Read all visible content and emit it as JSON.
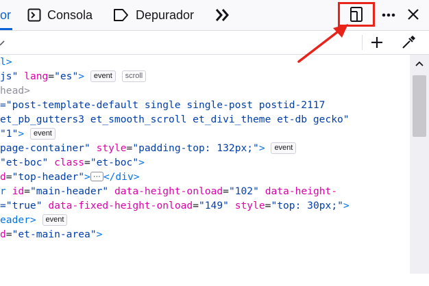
{
  "toolbar": {
    "tabs": [
      {
        "label": "or",
        "icon": "inspector-icon"
      },
      {
        "label": "Consola",
        "icon": "console-icon"
      },
      {
        "label": "Depurador",
        "icon": "debugger-icon"
      }
    ],
    "overflow_icon": "chevrons-right-icon",
    "responsive_icon": "responsive-design-icon",
    "more_icon": "more-dots-icon",
    "close_icon": "close-icon",
    "accent_color": "#0b63d8",
    "highlight_color": "#e8231a"
  },
  "search": {
    "placeholder": "",
    "add_node_icon": "plus-icon",
    "picker_icon": "eyedropper-icon"
  },
  "markup": {
    "l0": {
      "tag": "l>"
    },
    "l1": {
      "a": "js\"",
      "attr": "lang",
      "val": "\"es\"",
      "end": ">",
      "b1": "event",
      "b2": "scroll"
    },
    "l2": {
      "text": "head>"
    },
    "l3": {
      "val": "=\"post-template-default single single-post postid-2117"
    },
    "l4": {
      "val": "et_pb_gutters3 et_smooth_scroll et_divi_theme et-db gecko\""
    },
    "l5": {
      "val": "\"1\"",
      "end": ">",
      "b1": "event"
    },
    "l6": {
      "val": "page-container\"",
      "attr": "style",
      "val2": "\"padding-top: 132px;\"",
      "end": ">",
      "b1": "event"
    },
    "l7": {
      "val": "\"et-boc\"",
      "attr": "class",
      "val2": "\"et-boc\"",
      "end": ">"
    },
    "l8": {
      "a": "d",
      "val": "\"top-header\"",
      "end": ">",
      "close": "</div>"
    },
    "l9": {
      "tag": "r",
      "attr": "id",
      "val": "\"main-header\"",
      "attr2": "data-height-onload",
      "val2": "\"102\"",
      "attr3": "data-height-"
    },
    "l10": {
      "val": "=\"true\"",
      "attr": "data-fixed-height-onload",
      "val2": "\"149\"",
      "attr2": "style",
      "val3": "\"top: 30px;\"",
      "end": ">"
    },
    "l11": {
      "tag": "eader>",
      "b1": "event"
    },
    "l12": {
      "a": "d",
      "val": "\"et-main-area\"",
      "end": ">"
    }
  }
}
